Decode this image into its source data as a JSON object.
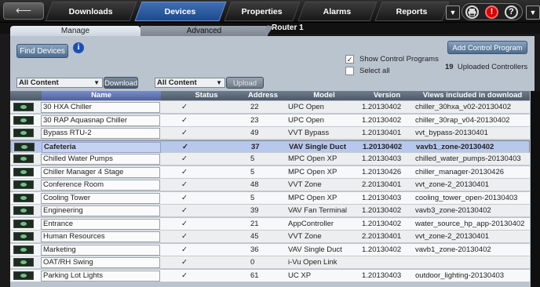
{
  "nav": {
    "back_label": "⟵",
    "tabs": [
      {
        "label": "Downloads"
      },
      {
        "label": "Devices"
      },
      {
        "label": "Properties"
      },
      {
        "label": "Alarms"
      },
      {
        "label": "Reports"
      }
    ],
    "icons": [
      "print-icon",
      "alarm-icon",
      "help-icon"
    ],
    "alarm_glyph": "!",
    "help_glyph": "?",
    "dropdown_glyph": "▼"
  },
  "breadcrumb": {
    "location": ": Router 1"
  },
  "subtabs": {
    "manage": "Manage",
    "advanced": "Advanced"
  },
  "toolbar": {
    "find_devices": "Find Devices",
    "info_glyph": "i",
    "add_control_program": "Add Control Program",
    "show_control_programs": "Show Control Programs",
    "show_control_programs_checked": "✓",
    "select_all": "Select all",
    "uploaded_count": "19",
    "uploaded_label": "Uploaded Controllers",
    "download_filter": "All Content",
    "download_button": "Download",
    "upload_filter": "All Content",
    "upload_button": "Upload"
  },
  "table": {
    "columns": [
      "Name",
      "Status",
      "Address",
      "Model",
      "Version",
      "Views included in download"
    ],
    "selected_row": 3,
    "rows": [
      {
        "name": "30 HXA Chiller",
        "status": "✓",
        "address": "22",
        "model": "UPC Open",
        "version": "1.20130402",
        "views": "chiller_30hxa_v02-20130402"
      },
      {
        "name": "30 RAP Aquasnap Chiller",
        "status": "✓",
        "address": "23",
        "model": "UPC Open",
        "version": "1.20130402",
        "views": "chiller_30rap_v04-20130402"
      },
      {
        "name": "Bypass RTU-2",
        "status": "✓",
        "address": "49",
        "model": "VVT Bypass",
        "version": "1.20130401",
        "views": "vvt_bypass-20130401"
      },
      {
        "name": "Cafeteria",
        "status": "✓",
        "address": "37",
        "model": "VAV Single Duct",
        "version": "1.20130402",
        "views": "vavb1_zone-20130402"
      },
      {
        "name": "Chilled Water Pumps",
        "status": "✓",
        "address": "5",
        "model": "MPC Open XP",
        "version": "1.20130403",
        "views": "chilled_water_pumps-20130403"
      },
      {
        "name": "Chiller Manager 4 Stage",
        "status": "✓",
        "address": "5",
        "model": "MPC Open XP",
        "version": "1.20130426",
        "views": "chiller_manager-20130426"
      },
      {
        "name": "Conference Room",
        "status": "✓",
        "address": "48",
        "model": "VVT Zone",
        "version": "2.20130401",
        "views": "vvt_zone-2_20130401"
      },
      {
        "name": "Cooling Tower",
        "status": "✓",
        "address": "5",
        "model": "MPC Open XP",
        "version": "1.20130403",
        "views": "cooling_tower_open-20130403"
      },
      {
        "name": "Engineering",
        "status": "✓",
        "address": "39",
        "model": "VAV Fan Terminal",
        "version": "1.20130402",
        "views": "vavb3_zone-20130402"
      },
      {
        "name": "Entrance",
        "status": "✓",
        "address": "21",
        "model": "AppController",
        "version": "1.20130402",
        "views": "water_source_hp_app-20130402"
      },
      {
        "name": "Human Resources",
        "status": "✓",
        "address": "45",
        "model": "VVT Zone",
        "version": "2.20130401",
        "views": "vvt_zone-2_20130401"
      },
      {
        "name": "Marketing",
        "status": "✓",
        "address": "36",
        "model": "VAV Single Duct",
        "version": "1.20130402",
        "views": "vavb1_zone-20130402"
      },
      {
        "name": "OAT/RH Swing",
        "status": "✓",
        "address": "0",
        "model": "i-Vu Open Link",
        "version": "",
        "views": ""
      },
      {
        "name": "Parking Lot Lights",
        "status": "✓",
        "address": "61",
        "model": "UC XP",
        "version": "1.20130403",
        "views": "outdoor_lighting-20130403"
      }
    ]
  }
}
